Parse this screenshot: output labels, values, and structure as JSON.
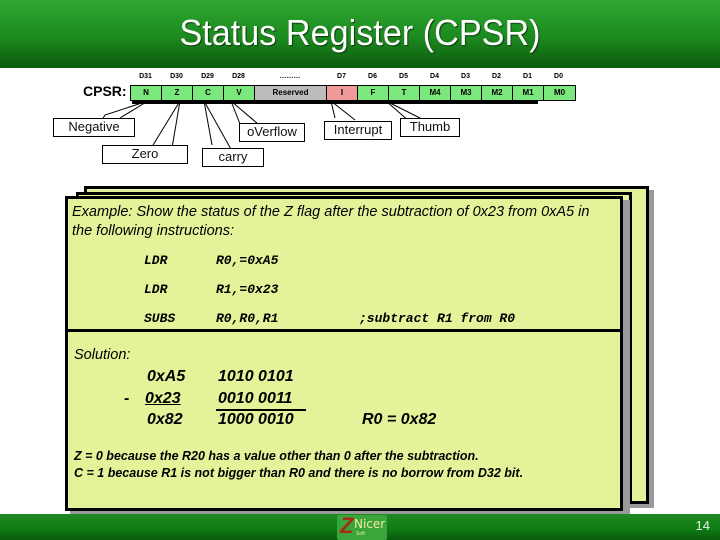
{
  "slide": {
    "title": "Status Register (CPSR)",
    "page_number": "14"
  },
  "register": {
    "label": "CPSR:",
    "cells": [
      {
        "bit": "D31",
        "name": "N",
        "color": "#7ae87c"
      },
      {
        "bit": "D30",
        "name": "Z",
        "color": "#7ae87c"
      },
      {
        "bit": "D29",
        "name": "C",
        "color": "#7ae87c"
      },
      {
        "bit": "D28",
        "name": "V",
        "color": "#7ae87c"
      },
      {
        "bit": "………",
        "name": "Reserved",
        "color": "#bcbcbc"
      },
      {
        "bit": "D7",
        "name": "I",
        "color": "#f09a9a"
      },
      {
        "bit": "D6",
        "name": "F",
        "color": "#7ae87c"
      },
      {
        "bit": "D5",
        "name": "T",
        "color": "#7ae87c"
      },
      {
        "bit": "D4",
        "name": "M4",
        "color": "#7ae87c"
      },
      {
        "bit": "D3",
        "name": "M3",
        "color": "#7ae87c"
      },
      {
        "bit": "D2",
        "name": "M2",
        "color": "#7ae87c"
      },
      {
        "bit": "D1",
        "name": "M1",
        "color": "#7ae87c"
      },
      {
        "bit": "D0",
        "name": "M0",
        "color": "#7ae87c"
      }
    ]
  },
  "flags": {
    "negative": "Negative",
    "zero": "Zero",
    "carry": "carry",
    "overflow": "oVerflow",
    "interrupt": "Interrupt",
    "thumb": "Thumb"
  },
  "example": {
    "prompt": "Example: Show the status of the Z flag after the subtraction of 0x23 from 0xA5 in the following instructions:",
    "code": [
      {
        "op": "LDR",
        "args": "R0,=0xA5",
        "comment": ""
      },
      {
        "op": "LDR",
        "args": "R1,=0x23",
        "comment": ""
      },
      {
        "op": "SUBS",
        "args": "R0,R0,R1",
        "comment": ";subtract R1 from R0"
      }
    ]
  },
  "solution": {
    "label": "Solution:",
    "minus": "-",
    "rows": [
      {
        "hex": "0xA5",
        "bin": "1010 0101"
      },
      {
        "hex": "0x23",
        "bin": "0010 0011"
      },
      {
        "hex": "0x82",
        "bin": "1000 0010"
      }
    ],
    "result": "R0 = 0x82",
    "explanations": [
      "Z = 0 because the R20 has a value other than 0 after the subtraction.",
      "C = 1 because R1 is not bigger than R0 and there is no borrow from D32 bit."
    ]
  },
  "footer": {
    "logo_letter": "Z",
    "logo_text": "Nicer",
    "logo_sub": "Soft"
  }
}
